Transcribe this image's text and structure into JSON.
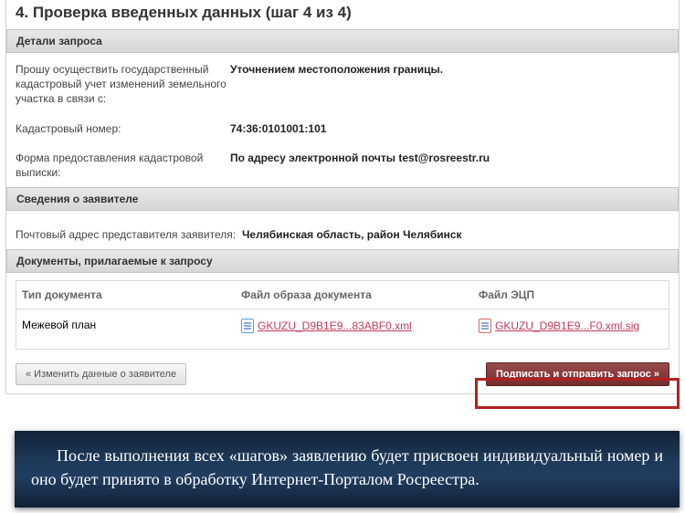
{
  "page": {
    "title": "4. Проверка введенных данных (шаг 4 из 4)"
  },
  "sections": {
    "details_header": "Детали запроса",
    "applicant_header": "Сведения о заявителе",
    "docs_header": "Документы, прилагаемые к запросу"
  },
  "details": {
    "reason_label": "Прошу осуществить государственный кадастровый учет изменений земельного участка в связи с:",
    "reason_value": "Уточнением местоположения границы.",
    "cadnum_label": "Кадастровый номер:",
    "cadnum_value": "74:36:0101001:101",
    "form_label": "Форма предоставления кадастровой выписки:",
    "form_value": "По адресу электронной почты test@rosreestr.ru"
  },
  "applicant": {
    "postal_label": "Почтовый адрес представителя заявителя:",
    "postal_value": "Челябинская область, район Челябинск"
  },
  "docs": {
    "col_type": "Тип документа",
    "col_file": "Файл образа документа",
    "col_sig": "Файл ЭЦП",
    "row_type": "Межевой план",
    "row_file": "GKUZU_D9B1E9...83ABF0.xml",
    "row_sig": "GKUZU_D9B1E9...F0.xml.sig"
  },
  "buttons": {
    "back": "« Изменить данные о заявителе",
    "submit": "Подписать и отправить запрос »"
  },
  "caption": "После выполнения всех «шагов» заявлению будет присвоен индивидуальный номер и оно будет принято в обработку Интернет-Порталом Росреестра."
}
